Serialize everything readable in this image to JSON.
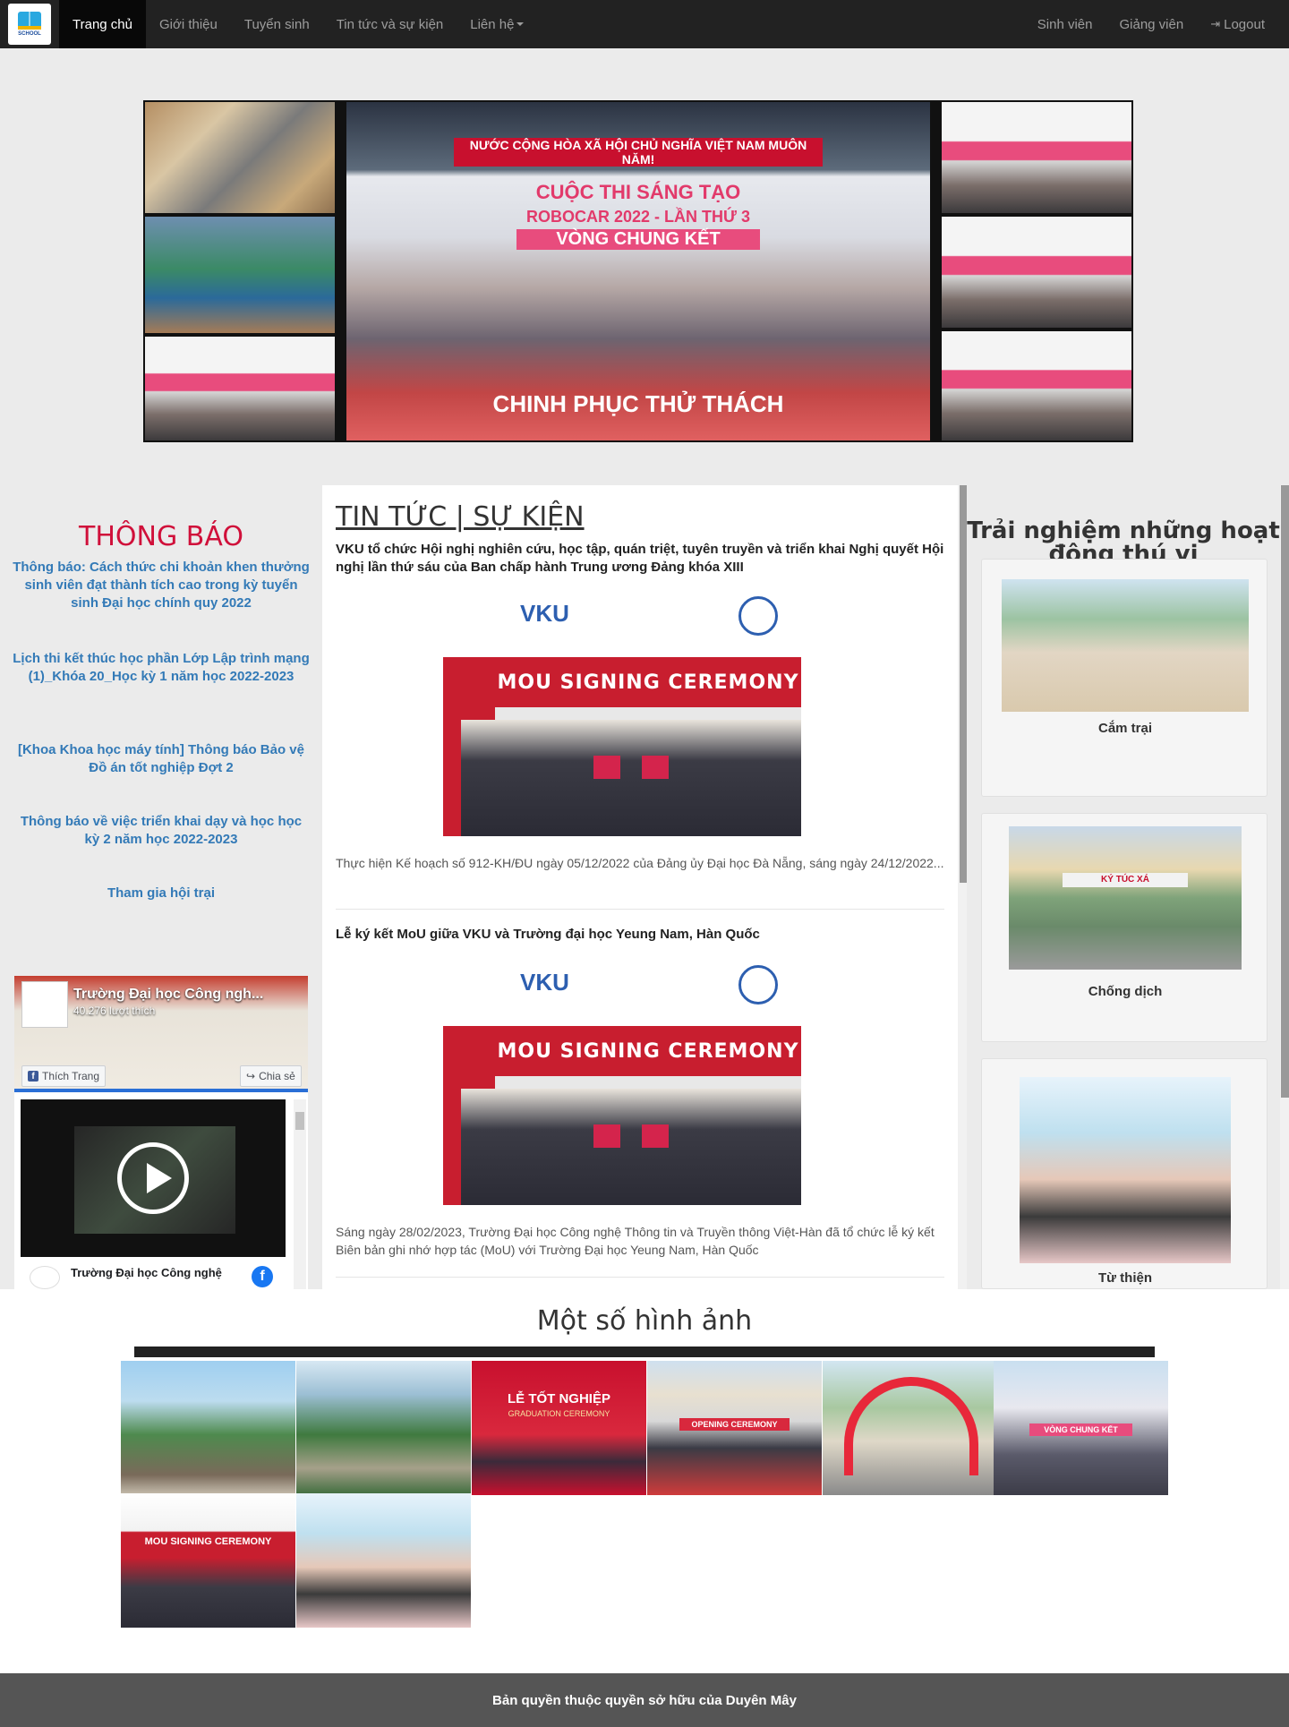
{
  "nav": {
    "brand_text": "SCHOOL",
    "left": [
      {
        "label": "Trang chủ"
      },
      {
        "label": "Giới thiệu"
      },
      {
        "label": "Tuyển sinh"
      },
      {
        "label": "Tin tức và sự kiện"
      },
      {
        "label": "Liên hệ"
      }
    ],
    "right": [
      {
        "label": "Sinh viên"
      },
      {
        "label": "Giảng viên"
      },
      {
        "label": "Logout"
      }
    ]
  },
  "hero": {
    "banner_line": "CUỘC THI SÁNG TẠO",
    "banner_sub": "ROBOCAR 2022 - LẦN THỨ 3",
    "banner_round": "VÒNG CHUNG KẾT",
    "slogan": "CHINH PHỤC THỬ THÁCH",
    "top_slogan": "NƯỚC CỘNG HÒA XÃ HỘI CHỦ NGHĨA VIỆT NAM MUÔN NĂM!"
  },
  "notice": {
    "title": "THÔNG BÁO",
    "items": [
      {
        "text": "Thông báo: Cách thức chi khoản khen thưởng sinh viên đạt thành tích cao trong kỳ tuyển sinh Đại học chính quy 2022"
      },
      {
        "text": "Lịch thi kết thúc học phần Lớp Lập trình mạng (1)_Khóa 20_Học kỳ 1 năm học 2022-2023"
      },
      {
        "text": "[Khoa Khoa học máy tính] Thông báo Bảo vệ Đồ án tốt nghiệp Đợt 2"
      },
      {
        "text": "Thông báo về việc triển khai dạy và học học kỳ 2 năm học 2022-2023"
      },
      {
        "text": "Tham gia hội trại"
      }
    ]
  },
  "facebook": {
    "page_name": "Trường Đại học Công ngh...",
    "likes": "40.276 lượt thích",
    "like_button": "Thích Trang",
    "share_button": "Chia sẻ",
    "footer_name": "Trường Đại học Công nghệ"
  },
  "news": {
    "heading": "TIN TỨC | SỰ KIỆN",
    "articles": [
      {
        "title": "VKU tổ chức Hội nghị nghiên cứu, học tập, quán triệt, tuyên truyền và triển khai Nghị quyết Hội nghị lần thứ sáu của Ban chấp hành Trung ương Đảng khóa XIII",
        "desc": "Thực hiện Kế hoạch số 912-KH/ĐU ngày 05/12/2022 của Đảng ủy Đại học Đà Nẵng, sáng ngày 24/12/2022..."
      },
      {
        "title": "Lễ ký kết MoU giữa VKU và Trường đại học Yeung Nam, Hàn Quốc",
        "desc": "Sáng ngày 28/02/2023, Trường Đại học Công nghệ Thông tin và Truyền thông Việt-Hàn đã tổ chức lễ ký kết Biên bản ghi nhớ hợp tác (MoU) với Trường Đại học Yeung Nam, Hàn Quốc"
      }
    ],
    "mou_banner": "MOU SIGNING CEREMONY",
    "mou_logo": "VKU"
  },
  "experience": {
    "title": "Trải nghiệm những hoạt động thú vị",
    "cards": [
      {
        "label": "Cắm trại"
      },
      {
        "label": "Chống dịch"
      },
      {
        "label": "Từ thiện"
      }
    ],
    "dorm_sign": "KÝ TÚC XÁ"
  },
  "gallery": {
    "title": "Một số hình ảnh",
    "captions": {
      "graduation": "LỄ TỐT NGHIỆP",
      "graduation_sub": "GRADUATION CEREMONY",
      "opening": "OPENING CEREMONY",
      "final": "VÒNG CHUNG KẾT",
      "mou": "MOU SIGNING CEREMONY"
    }
  },
  "footer": {
    "text": "Bản quyền thuộc quyền sở hữu của Duyên Mây"
  },
  "colors": {
    "navbar": "#222222",
    "notice_title": "#d0103a",
    "link": "#337ab7",
    "footer": "#555555"
  }
}
